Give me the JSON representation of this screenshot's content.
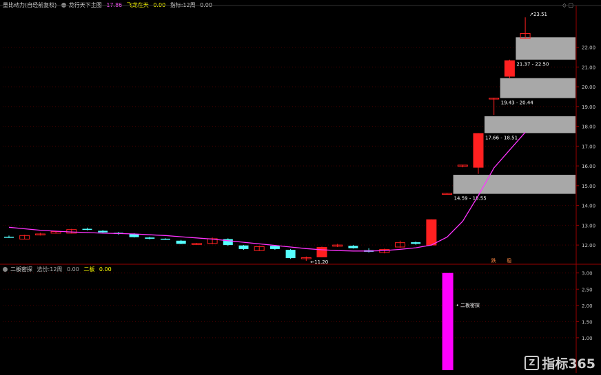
{
  "main_panel": {
    "labels": {
      "indicator_name": "量比动力(自经前复权)",
      "formula_name": "龙行天下主图",
      "value1": "17.86",
      "label2": "飞龙在天",
      "value2": "0.00",
      "label3": "指标:12周",
      "value3": "0.00"
    },
    "colors": {
      "up": "#ff2020",
      "down": "#55ffff",
      "ma": "#ff33ff",
      "zone": "#a8a8a8",
      "axis": "#9a0000",
      "text": "#cccccc"
    }
  },
  "sub_panel": {
    "labels": {
      "indicator_name": "二板密探",
      "label1": "选份:12周",
      "value1": "0.00",
      "label2": "二板",
      "value2": "0.00"
    },
    "annotation": "二板密探"
  },
  "window_controls": {
    "icons": [
      "diamond-icon",
      "restore-icon"
    ]
  },
  "watermark": {
    "text": "指标365",
    "logo": "Z"
  },
  "chart_data": [
    {
      "type": "candlestick",
      "ylim": [
        11.1,
        23.9
      ],
      "yticks": [
        12.0,
        13.0,
        14.0,
        15.0,
        16.0,
        17.0,
        18.0,
        19.0,
        20.0,
        21.0,
        22.0
      ],
      "candles": [
        {
          "o": 12.42,
          "h": 12.48,
          "l": 12.36,
          "c": 12.4
        },
        {
          "o": 12.3,
          "h": 12.52,
          "l": 12.28,
          "c": 12.48
        },
        {
          "o": 12.52,
          "h": 12.62,
          "l": 12.48,
          "c": 12.56
        },
        {
          "o": 12.6,
          "h": 12.72,
          "l": 12.58,
          "c": 12.68
        },
        {
          "o": 12.6,
          "h": 12.82,
          "l": 12.58,
          "c": 12.78
        },
        {
          "o": 12.82,
          "h": 12.88,
          "l": 12.74,
          "c": 12.8
        },
        {
          "o": 12.72,
          "h": 12.76,
          "l": 12.6,
          "c": 12.64
        },
        {
          "o": 12.62,
          "h": 12.66,
          "l": 12.52,
          "c": 12.58
        },
        {
          "o": 12.56,
          "h": 12.6,
          "l": 12.38,
          "c": 12.4
        },
        {
          "o": 12.38,
          "h": 12.42,
          "l": 12.28,
          "c": 12.32
        },
        {
          "o": 12.32,
          "h": 12.34,
          "l": 12.26,
          "c": 12.3
        },
        {
          "o": 12.22,
          "h": 12.26,
          "l": 12.04,
          "c": 12.06
        },
        {
          "o": 12.04,
          "h": 12.1,
          "l": 12.02,
          "c": 12.08
        },
        {
          "o": 12.08,
          "h": 12.38,
          "l": 12.04,
          "c": 12.32
        },
        {
          "o": 12.3,
          "h": 12.34,
          "l": 11.96,
          "c": 12.0
        },
        {
          "o": 11.98,
          "h": 12.0,
          "l": 11.76,
          "c": 11.8
        },
        {
          "o": 11.72,
          "h": 11.96,
          "l": 11.7,
          "c": 11.92
        },
        {
          "o": 11.96,
          "h": 11.98,
          "l": 11.76,
          "c": 11.8
        },
        {
          "o": 11.76,
          "h": 11.8,
          "l": 11.3,
          "c": 11.34
        },
        {
          "o": 11.34,
          "h": 11.42,
          "l": 11.2,
          "c": 11.36
        },
        {
          "o": 11.4,
          "h": 11.92,
          "l": 11.38,
          "c": 11.88
        },
        {
          "o": 11.94,
          "h": 12.06,
          "l": 11.9,
          "c": 12.0
        },
        {
          "o": 11.96,
          "h": 12.0,
          "l": 11.82,
          "c": 11.84
        },
        {
          "o": 11.74,
          "h": 11.84,
          "l": 11.62,
          "c": 11.66
        },
        {
          "o": 11.62,
          "h": 11.82,
          "l": 11.58,
          "c": 11.78
        },
        {
          "o": 11.9,
          "h": 12.22,
          "l": 11.86,
          "c": 12.12
        },
        {
          "o": 12.14,
          "h": 12.18,
          "l": 12.02,
          "c": 12.06
        },
        {
          "o": 12.0,
          "h": 13.3,
          "l": 11.96,
          "c": 13.28
        },
        {
          "o": 14.6,
          "h": 14.62,
          "l": 14.58,
          "c": 14.61
        },
        {
          "o": 15.98,
          "h": 16.06,
          "l": 15.93,
          "c": 16.04
        },
        {
          "o": 15.93,
          "h": 17.66,
          "l": 15.6,
          "c": 17.64
        },
        {
          "o": 19.43,
          "h": 19.45,
          "l": 18.58,
          "c": 19.43
        },
        {
          "o": 20.53,
          "h": 21.37,
          "l": 20.45,
          "c": 21.32
        },
        {
          "o": 22.45,
          "h": 23.51,
          "l": 22.45,
          "c": 22.7
        }
      ],
      "ma_line": [
        12.9,
        12.82,
        12.75,
        12.7,
        12.66,
        12.63,
        12.6,
        12.58,
        12.56,
        12.52,
        12.48,
        12.42,
        12.36,
        12.3,
        12.22,
        12.14,
        12.06,
        11.98,
        11.9,
        11.82,
        11.76,
        11.72,
        11.7,
        11.7,
        11.72,
        11.78,
        11.86,
        12.0,
        12.4,
        13.2,
        14.5,
        15.9,
        16.8,
        17.7
      ],
      "zones": [
        {
          "from": 14.59,
          "to": 15.55,
          "label": "14.59 - 15.55",
          "start": 28
        },
        {
          "from": 17.66,
          "to": 18.51,
          "label": "17.66 - 18.51",
          "start": 30
        },
        {
          "from": 19.43,
          "to": 20.44,
          "label": "19.43 - 20.44",
          "start": 31
        },
        {
          "from": 21.37,
          "to": 22.5,
          "label": "21.37 - 22.50",
          "start": 32
        }
      ],
      "annotations": [
        {
          "text": "11.20",
          "bar": 19
        },
        {
          "text": "23.51",
          "bar": 33
        }
      ],
      "markers": [
        {
          "text": "跌",
          "bar": 31
        },
        {
          "text": "稳",
          "bar": 32
        }
      ]
    },
    {
      "type": "bar",
      "ylim": [
        0,
        3.1
      ],
      "yticks": [
        1.0,
        1.5,
        2.0,
        2.5,
        3.0
      ],
      "bars": [
        {
          "bar": 28,
          "value": 3.0
        }
      ],
      "bar_color": "#ff00ff"
    }
  ]
}
